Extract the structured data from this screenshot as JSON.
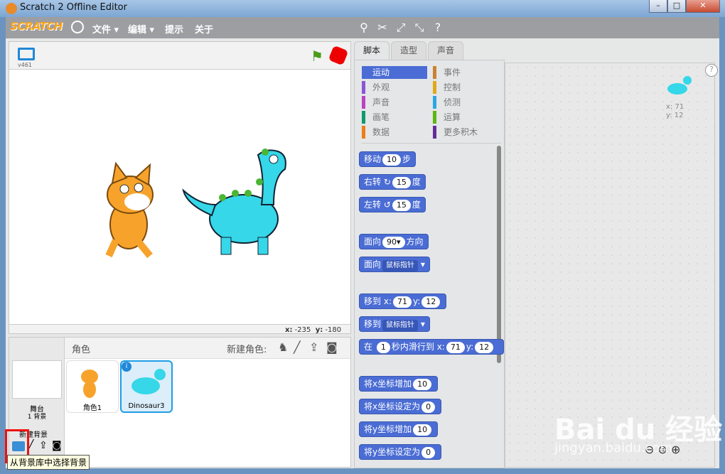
{
  "window": {
    "title": "Scratch 2 Offline Editor",
    "min": "–",
    "max": "□",
    "close": "✕"
  },
  "menubar": {
    "logo": "SCRATCH",
    "file": "文件",
    "edit": "编辑",
    "tips": "提示",
    "about": "关于"
  },
  "stage": {
    "version": "v461",
    "x_label": "x:",
    "x_value": "-235",
    "y_label": "y:",
    "y_value": "-180"
  },
  "sprites": {
    "header": "角色",
    "new_sprite": "新建角色:",
    "items": [
      {
        "name": "角色1"
      },
      {
        "name": "Dinosaur3"
      }
    ]
  },
  "stage_thumb": {
    "label": "舞台",
    "sub": "1 背景",
    "new_backdrop": "新建背景"
  },
  "tooltip": "从背景库中选择背景",
  "tabs": [
    "脚本",
    "造型",
    "声音"
  ],
  "categories": [
    {
      "label": "运动",
      "color": "#4a6cd4"
    },
    {
      "label": "事件",
      "color": "#c88330"
    },
    {
      "label": "外观",
      "color": "#8a55d7"
    },
    {
      "label": "控制",
      "color": "#e1a91a"
    },
    {
      "label": "声音",
      "color": "#bb42c3"
    },
    {
      "label": "侦测",
      "color": "#2ca5e2"
    },
    {
      "label": "画笔",
      "color": "#0e9a6c"
    },
    {
      "label": "运算",
      "color": "#5cb712"
    },
    {
      "label": "数据",
      "color": "#ee7d16"
    },
    {
      "label": "更多积木",
      "color": "#632d99"
    }
  ],
  "blocks": {
    "move": {
      "a": "移动",
      "v": "10",
      "b": "步"
    },
    "turn_r": {
      "a": "右转",
      "v": "15",
      "b": "度"
    },
    "turn_l": {
      "a": "左转",
      "v": "15",
      "b": "度"
    },
    "point_dir": {
      "a": "面向",
      "v": "90▾",
      "b": "方向"
    },
    "point_towards": {
      "a": "面向",
      "v": "鼠标指针"
    },
    "goto_xy": {
      "a": "移到",
      "xl": "x:",
      "x": "71",
      "yl": "y:",
      "y": "12"
    },
    "goto": {
      "a": "移到",
      "v": "鼠标指针"
    },
    "glide": {
      "a": "在",
      "v": "1",
      "b": "秒内滑行到",
      "xl": "x:",
      "x": "71",
      "yl": "y:",
      "y": "12"
    },
    "change_x": {
      "a": "将x坐标增加",
      "v": "10"
    },
    "set_x": {
      "a": "将x坐标设定为",
      "v": "0"
    },
    "change_y": {
      "a": "将y坐标增加",
      "v": "10"
    },
    "set_y": {
      "a": "将y坐标设定为",
      "v": "0"
    }
  },
  "scripts_sprite": {
    "x": "x: 71",
    "y": "y: 12"
  },
  "watermark": {
    "brand": "Bai du 经验",
    "url": "jingyan.baidu.com"
  }
}
